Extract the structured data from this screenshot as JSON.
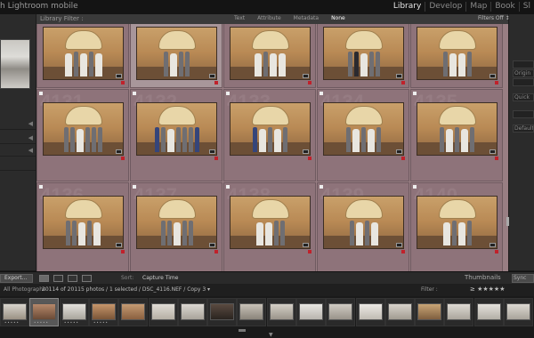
{
  "app": {
    "title": "h Lightroom mobile"
  },
  "modules": [
    "Library",
    "Develop",
    "Map",
    "Book",
    "Sl"
  ],
  "active_module": "Library",
  "filter_bar": {
    "title": "Library Filter :",
    "tabs": [
      "Text",
      "Attribute",
      "Metadata",
      "None"
    ],
    "active_tab": "None",
    "filter_state": "Filters Off ↕"
  },
  "right_panel": {
    "labels": [
      "Origin",
      "Quick",
      "Default"
    ]
  },
  "toolbar": {
    "export_label": "Export...",
    "sort_label": "Sort:",
    "sort_value": "Capture Time",
    "thumbnails_label": "Thumbnails",
    "sync_label": "Sync"
  },
  "filmstrip": {
    "source": "All Photographs",
    "path": "20114 of 20115 photos / 1 selected / DSC_4116.NEF / Copy 3 ▾",
    "filter_label": "Filter :",
    "stars": "≥ ★★★★★"
  },
  "grid": {
    "rows": 3,
    "cols": 5,
    "selected_index": 1,
    "cells": [
      {
        "index": "4126"
      },
      {
        "index": "4127"
      },
      {
        "index": "4128"
      },
      {
        "index": "4129"
      },
      {
        "index": "4130"
      },
      {
        "index": "4131"
      },
      {
        "index": "4132"
      },
      {
        "index": "4133"
      },
      {
        "index": "4134"
      },
      {
        "index": "4135"
      },
      {
        "index": "4136"
      },
      {
        "index": "4137"
      },
      {
        "index": "4138"
      },
      {
        "index": "4139"
      },
      {
        "index": "4140"
      }
    ]
  },
  "colors": {
    "grid_background": "#987e83",
    "cell_background": "#8e737a",
    "selected_cell": "#a8969a",
    "flag_red": "#c0212b"
  }
}
